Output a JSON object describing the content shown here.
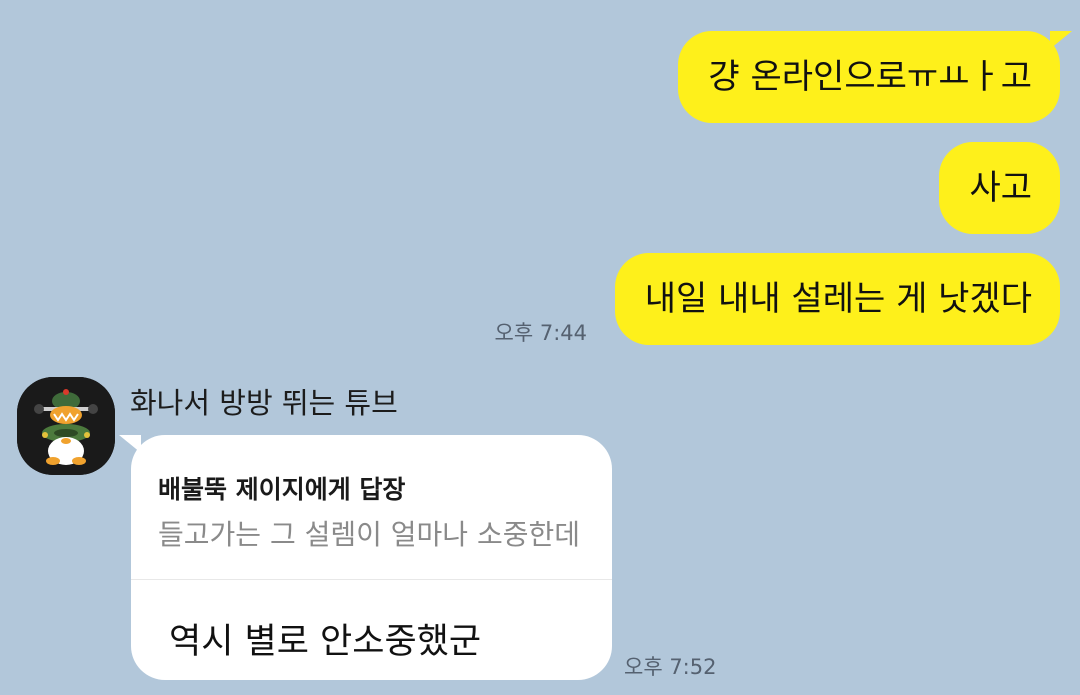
{
  "colors": {
    "background": "#b2c7da",
    "my_bubble": "#fef01b",
    "their_bubble": "#ffffff",
    "timestamp": "#556170"
  },
  "messages_sent": [
    {
      "text": "걍 온라인으로ㅠㅛㅏ고"
    },
    {
      "text": "사고"
    },
    {
      "text": "내일 내내 설레는 게 낫겠다",
      "time": "오후 7:44"
    }
  ],
  "received": {
    "sender": "화나서 방방 뛰는 튜브",
    "avatar_icon": "avatar-character-icon",
    "reply_header": "배불뚝 제이지에게 답장",
    "reply_quote": "들고가는 그 설렘이 얼마나 소중한데",
    "text": "역시 별로 안소중했군",
    "time": "오후 7:52"
  }
}
